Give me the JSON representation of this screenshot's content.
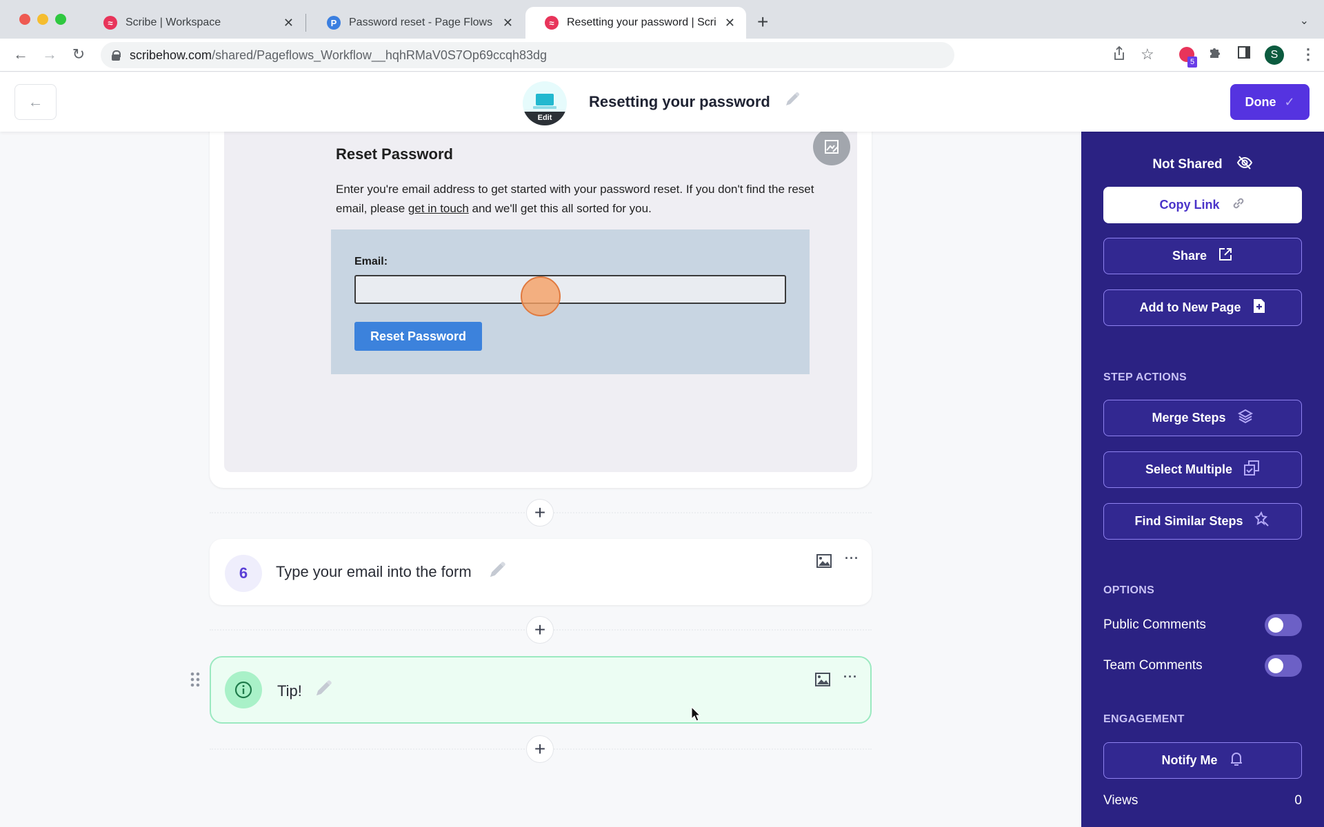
{
  "browser": {
    "tabs": [
      {
        "title": "Scribe | Workspace",
        "favicon": "scribe-logo",
        "active": false
      },
      {
        "title": "Password reset - Page Flows -",
        "favicon": "P",
        "active": false
      },
      {
        "title": "Resetting your password | Scri",
        "favicon": "scribe-logo",
        "active": true
      }
    ],
    "url_host": "scribehow.com",
    "url_path": "/shared/Pageflows_Workflow__hqhRMaV0S7Op69ccqh83dg",
    "extension_badge": "5",
    "profile_initial": "S"
  },
  "header": {
    "doc_title": "Resetting your password",
    "icon_edit_label": "Edit",
    "done_label": "Done"
  },
  "screenshot_content": {
    "title": "Reset Password",
    "desc_before_link": "Enter you're email address to get started with your password reset. If you don't find the reset email, please ",
    "desc_link": "get in touch",
    "desc_after_link": " and we'll get this all sorted for you.",
    "email_label": "Email:",
    "button_label": "Reset Password"
  },
  "steps": [
    {
      "number": "6",
      "text": "Type your email into the form"
    }
  ],
  "tip": {
    "text": "Tip!"
  },
  "sidebar": {
    "share_status": "Not Shared",
    "buttons": {
      "copy_link": "Copy Link",
      "share": "Share",
      "add_to_page": "Add to New Page"
    },
    "step_actions_heading": "STEP ACTIONS",
    "step_actions": {
      "merge": "Merge Steps",
      "select_multiple": "Select Multiple",
      "find_similar": "Find Similar Steps"
    },
    "options_heading": "OPTIONS",
    "options": [
      {
        "label": "Public Comments",
        "enabled": false
      },
      {
        "label": "Team Comments",
        "enabled": false
      }
    ],
    "engagement_heading": "ENGAGEMENT",
    "notify_label": "Notify Me",
    "views_label": "Views",
    "views_value": "0"
  }
}
